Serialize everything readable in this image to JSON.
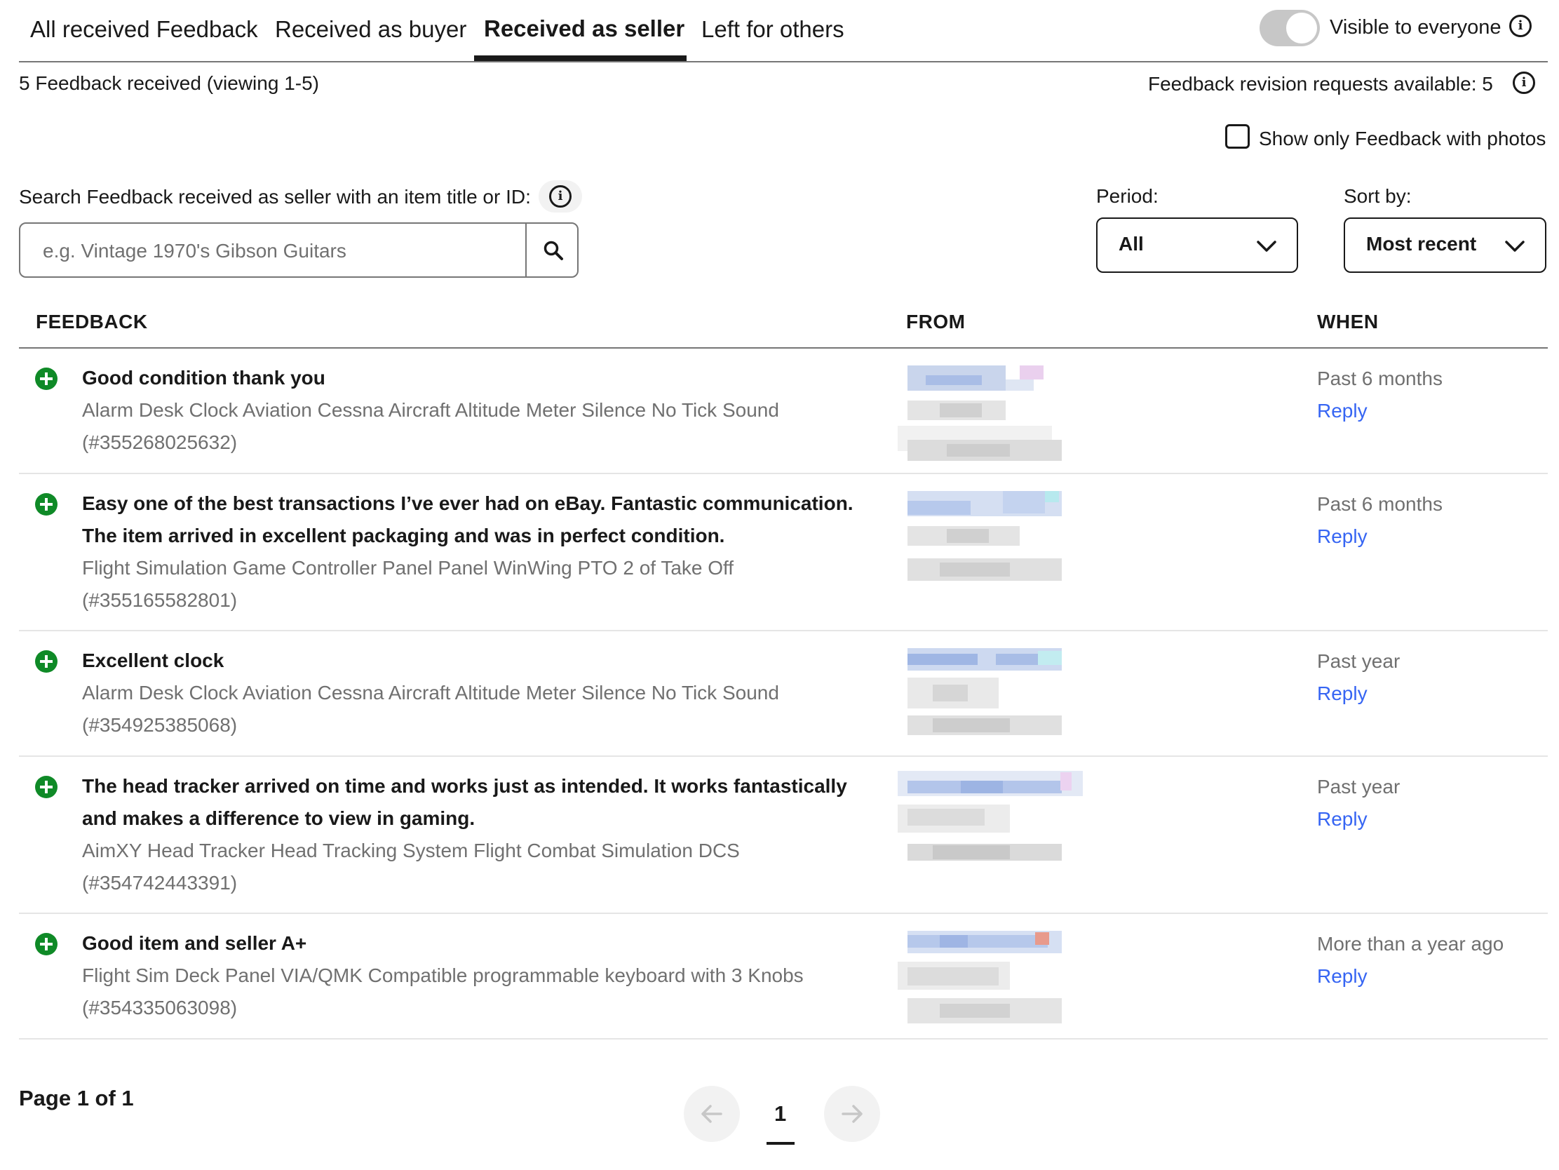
{
  "tabs": [
    {
      "label": "All received Feedback"
    },
    {
      "label": "Received as buyer"
    },
    {
      "label": "Received as seller"
    },
    {
      "label": "Left for others"
    }
  ],
  "active_tab": "Received as seller",
  "visibility": {
    "label": "Visible to everyone",
    "on": true
  },
  "summary": {
    "count_text": "5 Feedback received (viewing 1-5)",
    "revision_text": "Feedback revision requests available: 5"
  },
  "photos_filter": {
    "label": "Show only Feedback with photos",
    "checked": false
  },
  "search": {
    "label": "Search Feedback received as seller with an item title or ID:",
    "placeholder": "e.g. Vintage 1970's Gibson Guitars"
  },
  "period": {
    "label": "Period:",
    "value": "All"
  },
  "sort": {
    "label": "Sort by:",
    "value": "Most recent"
  },
  "table": {
    "headers": {
      "feedback": "FEEDBACK",
      "from": "FROM",
      "when": "WHEN"
    },
    "rows": [
      {
        "title": "Good condition thank you",
        "item": "Alarm Desk Clock Aviation Cessna Aircraft Altitude Meter Silence No Tick Sound",
        "item_id": "(#355268025632)",
        "when": "Past 6 months",
        "reply": "Reply"
      },
      {
        "title": "Easy one of the best transactions I’ve ever had on eBay. Fantastic communication. The item arrived in excellent packaging and was in perfect condition.",
        "item": "Flight Simulation Game Controller Panel Panel WinWing PTO 2 of Take Off",
        "item_id": "(#355165582801)",
        "when": "Past 6 months",
        "reply": "Reply"
      },
      {
        "title": "Excellent clock",
        "item": "Alarm Desk Clock Aviation Cessna Aircraft Altitude Meter Silence No Tick Sound",
        "item_id": "(#354925385068)",
        "when": "Past year",
        "reply": "Reply"
      },
      {
        "title": "The head tracker arrived on time and works just as intended. It works fantastically and makes a difference to view in gaming.",
        "item": "AimXY Head Tracker Head Tracking System Flight Combat Simulation DCS",
        "item_id": "(#354742443391)",
        "when": "Past year",
        "reply": "Reply"
      },
      {
        "title": "Good item and seller A+",
        "item": "Flight Sim Deck Panel VIA/QMK Compatible programmable keyboard with 3 Knobs",
        "item_id": "(#354335063098)",
        "when": "More than a year ago",
        "reply": "Reply"
      }
    ]
  },
  "pagination": {
    "page_text": "Page 1 of 1",
    "current_page": "1"
  },
  "colors": {
    "positive": "#0f8a27",
    "link": "#3665f3",
    "muted": "#707070",
    "text": "#191919"
  }
}
